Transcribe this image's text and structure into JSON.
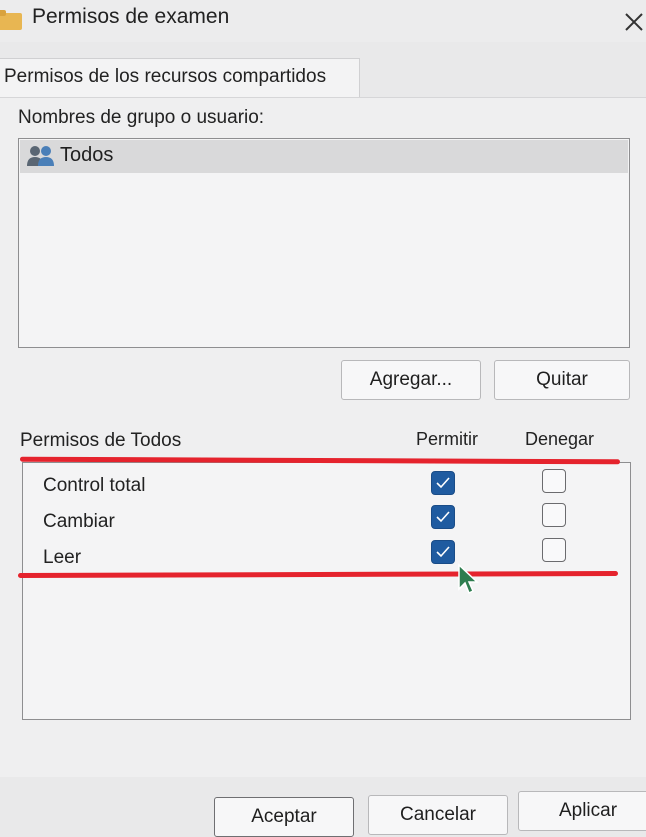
{
  "window": {
    "title": "Permisos de examen"
  },
  "tab": {
    "label": "Permisos de los recursos compartidos"
  },
  "groups": {
    "label": "Nombres de grupo o usuario:",
    "items": [
      {
        "label": "Todos",
        "icon": "users-icon"
      }
    ]
  },
  "group_buttons": {
    "add": "Agregar...",
    "remove": "Quitar"
  },
  "permissions": {
    "header": "Permisos de Todos",
    "col_allow": "Permitir",
    "col_deny": "Denegar",
    "rows": [
      {
        "label": "Control total",
        "allow": true,
        "deny": false
      },
      {
        "label": "Cambiar",
        "allow": true,
        "deny": false
      },
      {
        "label": "Leer",
        "allow": true,
        "deny": false
      }
    ]
  },
  "dialog_buttons": {
    "accept": "Aceptar",
    "cancel": "Cancelar",
    "apply": "Aplicar"
  },
  "annotation_color": "#e5232d",
  "checkbox_color": "#1f5ba0"
}
